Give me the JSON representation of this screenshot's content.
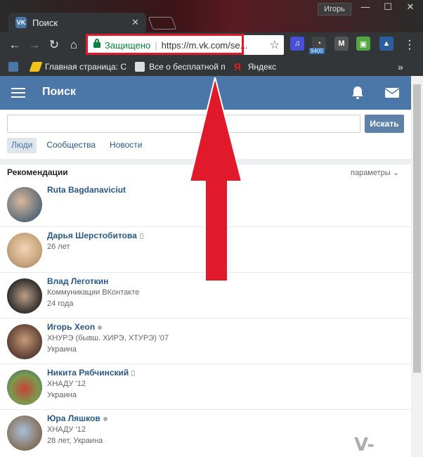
{
  "window": {
    "user_label": "Игорь",
    "minimize": "—",
    "maximize": "☐",
    "close": "✕"
  },
  "tab": {
    "favicon": "VK",
    "title": "Поиск",
    "close": "✕"
  },
  "omnibox": {
    "secure_label": "Защищено",
    "separator": "|",
    "url": "https://m.vk.com/se..."
  },
  "extensions": {
    "badge": "9400"
  },
  "bookmarks": [
    {
      "label": ""
    },
    {
      "label": "Главная страница: С"
    },
    {
      "label": "Все о бесплатной п"
    },
    {
      "label": "Яндекс"
    }
  ],
  "bookmarks_more": "»",
  "vk": {
    "header_title": "Поиск",
    "search": {
      "value": "",
      "placeholder": "",
      "button": "Искать"
    },
    "tabs": [
      {
        "label": "Люди",
        "active": true
      },
      {
        "label": "Сообщества",
        "active": false
      },
      {
        "label": "Новости",
        "active": false
      }
    ],
    "recommendations_title": "Рекомендации",
    "params_label": "параметры ⌄",
    "people": [
      {
        "name": "Ruta Bagdanaviciut",
        "line1": "",
        "line2": "",
        "status": "none"
      },
      {
        "name": "Дарья Шерстобитова",
        "line1": "26 лет",
        "line2": "",
        "status": "mobile"
      },
      {
        "name": "Влад Леготкин",
        "line1": "Коммуникации ВКонтакте",
        "line2": "24 года",
        "status": "none"
      },
      {
        "name": "Игорь Хеоn",
        "line1": "ХНУРЭ (бывш. ХИРЭ, ХТУРЭ) '07",
        "line2": "Украина",
        "status": "online"
      },
      {
        "name": "Никита Рябчинский",
        "line1": "ХНАДУ '12",
        "line2": "Украина",
        "status": "mobile"
      },
      {
        "name": "Юра Ляшков",
        "line1": "ХНАДУ '12",
        "line2": "28 лет, Украина",
        "status": "online"
      }
    ]
  },
  "watermark": "V-PC.RU",
  "colors": {
    "vk_blue": "#4a76a8",
    "link": "#2a5885",
    "highlight_red": "#e0192b"
  }
}
